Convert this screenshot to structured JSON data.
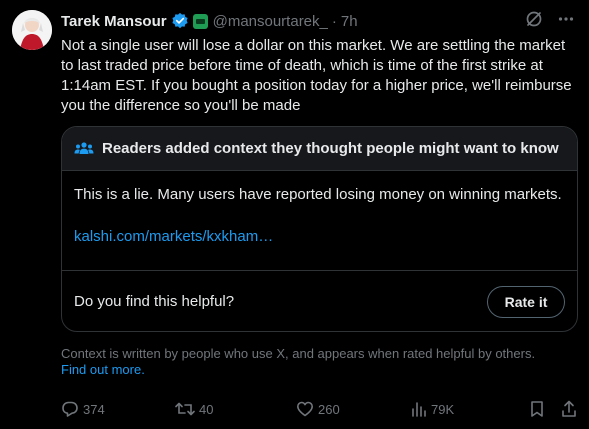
{
  "tweet": {
    "author_name": "Tarek Mansour",
    "handle": "@mansourtarek_",
    "separator": "·",
    "time": "7h",
    "text": "Not a single user will lose a dollar on this market. We are settling the market to last traded price before time of death, which is time of the first strike at 1:14am EST. If you bought a position today for a higher price, we'll reimburse you the difference so you'll be made"
  },
  "community_note": {
    "header": "Readers added context they thought people might want to know",
    "body": "This is a lie.  Many users have reported losing money on winning markets.",
    "link": "kalshi.com/markets/kxkham…",
    "question": "Do you find this helpful?",
    "rate_label": "Rate it"
  },
  "context_info": {
    "text": "Context is written by people who use X, and appears when rated helpful by others.",
    "link": "Find out more."
  },
  "actions": {
    "replies": "374",
    "reposts": "40",
    "likes": "260",
    "views": "79K"
  },
  "colors": {
    "background": "#000000",
    "text": "#e7e9ea",
    "muted": "#71767b",
    "link": "#1d9bf0",
    "border": "#2f3336",
    "verified": "#1d9bf0"
  },
  "icons": [
    "verified-badge-icon",
    "affiliate-badge-icon",
    "grok-icon",
    "more-icon",
    "people-icon",
    "reply-icon",
    "repost-icon",
    "like-icon",
    "views-icon",
    "bookmark-icon",
    "share-icon"
  ]
}
